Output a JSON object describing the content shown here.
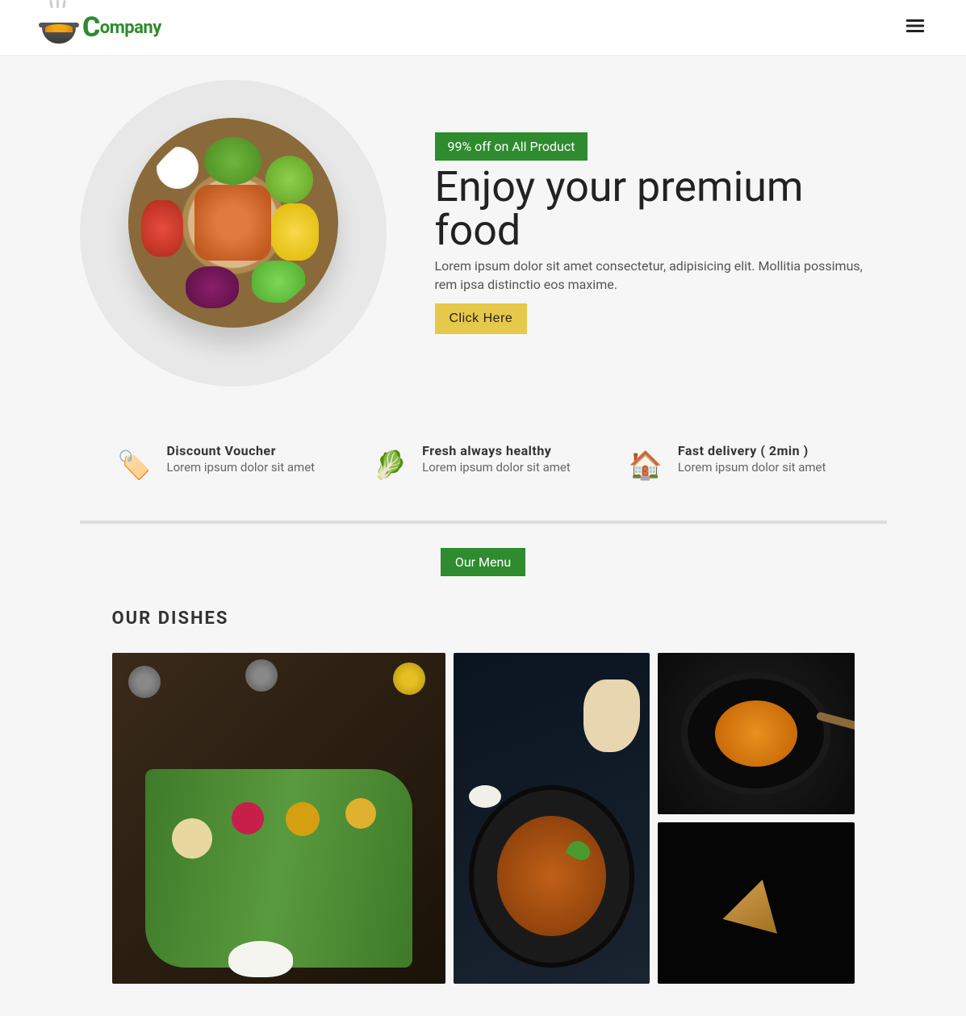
{
  "header": {
    "logo_text": "ompany",
    "logo_cap": "C"
  },
  "hero": {
    "badge": "99% off on All Product",
    "title": "Enjoy your premium food",
    "description": "Lorem ipsum dolor sit amet consectetur, adipisicing elit. Mollitia possimus, rem ipsa distinctio eos maxime.",
    "cta": "Click Here"
  },
  "features": [
    {
      "title": "Discount Voucher",
      "desc": "Lorem ipsum dolor sit amet",
      "icon": "🏷️"
    },
    {
      "title": "Fresh always healthy",
      "desc": "Lorem ipsum dolor sit amet",
      "icon": "🥬"
    },
    {
      "title": "Fast delivery ( 2min )",
      "desc": "Lorem ipsum dolor sit amet",
      "icon": "🏠"
    }
  ],
  "menu": {
    "badge": "Our Menu",
    "heading": "OUR DISHES"
  }
}
